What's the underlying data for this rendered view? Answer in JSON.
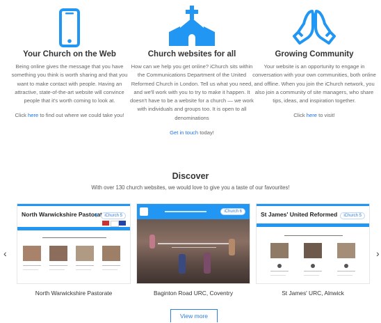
{
  "colors": {
    "accent": "#2196f3",
    "link": "#1a73e8",
    "heading": "#333333"
  },
  "features": [
    {
      "icon": "smartphone-icon",
      "title": "Your Church on the Web",
      "body": "Being online gives the message that you have something you think is worth sharing and that you want to make contact with people. Having an attractive, state-of-the-art website will convince people that it's worth coming to look at.",
      "cta_pre": "Click ",
      "cta_link": "here",
      "cta_post": " to find out where we could take you!"
    },
    {
      "icon": "church-icon",
      "title": "Church websites for all",
      "body": "How can we help you get online? iChurch sits within the Communications Department of the United Reformed Church in London. Tell us what you need, and we'll work with you to try to make it happen. It doesn't have to be a website for a church — we work with individuals and groups too. It is open to all denominations",
      "cta_pre": "",
      "cta_link": "Get in touch",
      "cta_post": " today!"
    },
    {
      "icon": "praying-hands-icon",
      "title": "Growing Community",
      "body": "Your website is an opportunity to engage in conversation with your own communities, both online and offline. When you join the iChurch network, you also join a community of site managers, who share tips, ideas, and inspiration together.",
      "cta_pre": "Click ",
      "cta_link": "here",
      "cta_post": " to visit!"
    }
  ],
  "discover": {
    "title": "Discover",
    "subtitle": "With over 130 church websites, we would love to give you a taste of our favourites!"
  },
  "carousel": {
    "prev_icon": "chevron-left-icon",
    "next_icon": "chevron-right-icon",
    "cards": [
      {
        "caption": "North Warwickshire Pastorate",
        "site_title": "North Warwickshire Pastorate",
        "badge": "iChurch 5"
      },
      {
        "caption": "Baginton Road URC, Coventry",
        "site_title": "",
        "badge": "iChurch 6"
      },
      {
        "caption": "St James' URC, Alnwick",
        "site_title": "St James' United Reformed",
        "badge": "iChurch 5"
      }
    ]
  },
  "view_more": "View more"
}
